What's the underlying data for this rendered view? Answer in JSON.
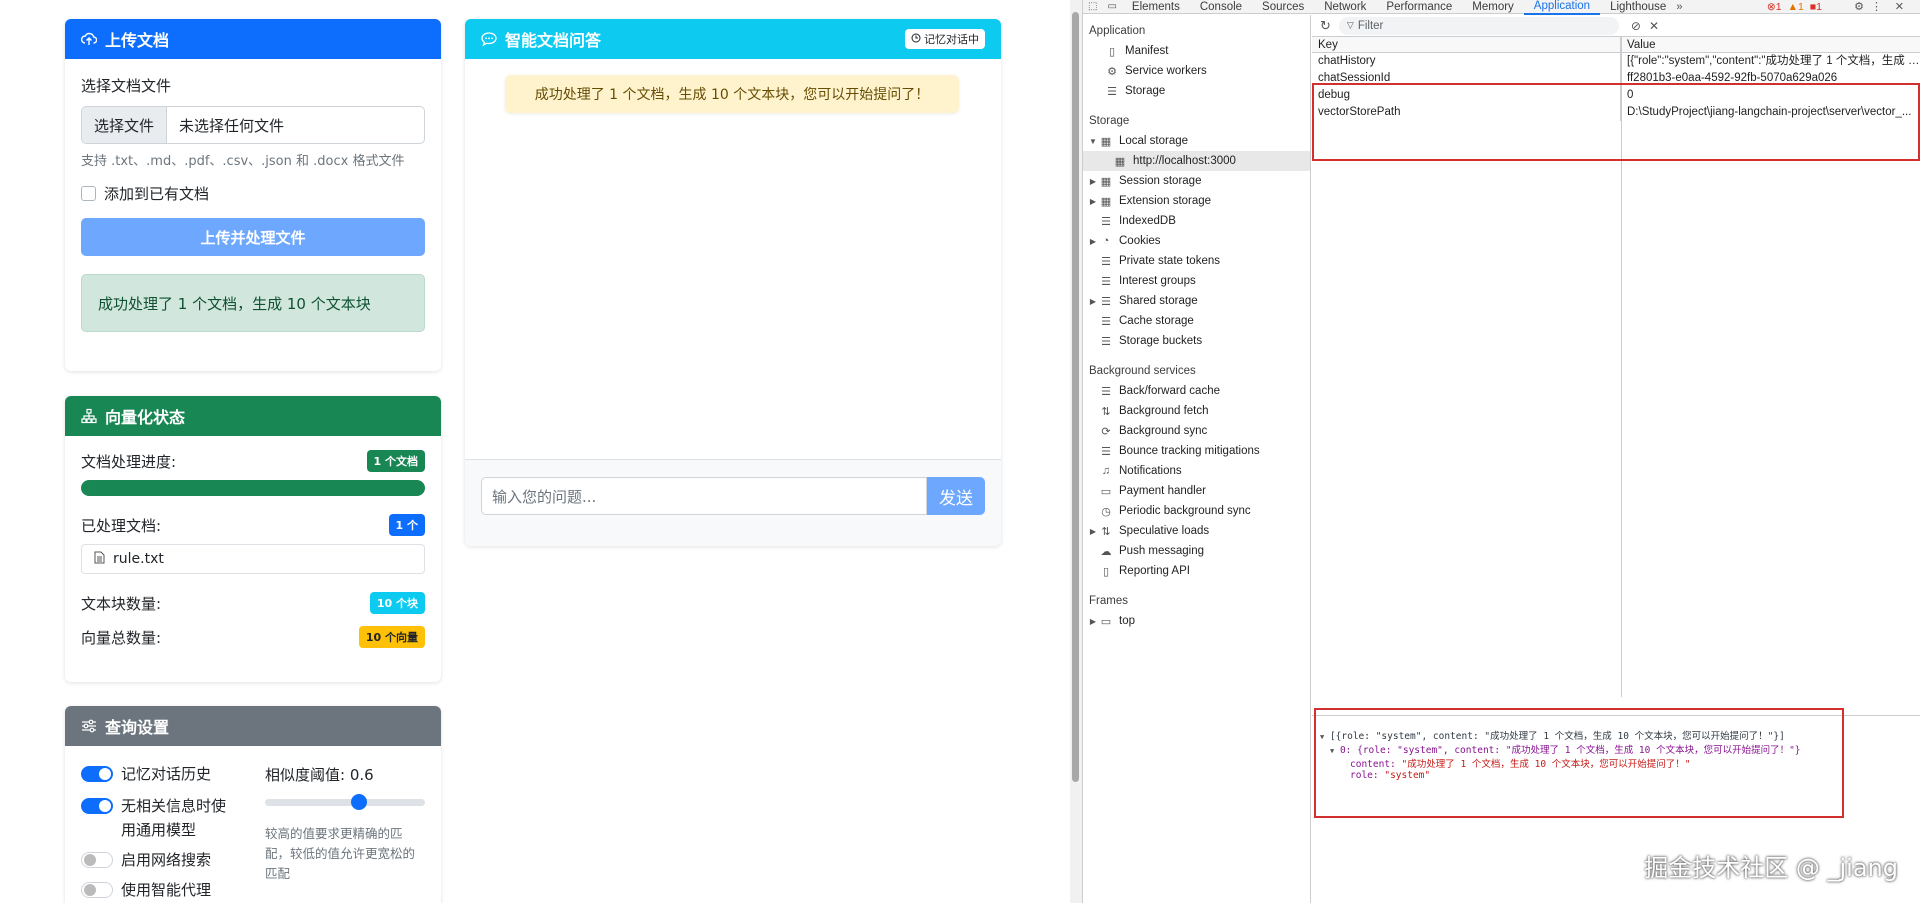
{
  "upload_card": {
    "title": "上传文档",
    "choose_label": "选择文档文件",
    "file_button": "选择文件",
    "file_name": "未选择任何文件",
    "hint": "支持 .txt、.md、.pdf、.csv、.json 和 .docx 格式文件",
    "append_label": "添加到已有文档",
    "upload_button": "上传并处理文件",
    "success_message": "成功处理了 1 个文档，生成 10 个文本块"
  },
  "vector_card": {
    "title": "向量化状态",
    "progress_label": "文档处理进度:",
    "progress_badge": "1 个文档",
    "progress_percent": 100,
    "processed_label": "已处理文档:",
    "processed_badge": "1 个",
    "files": [
      "rule.txt"
    ],
    "chunks_label": "文本块数量:",
    "chunks_badge": "10 个块",
    "vectors_label": "向量总数量:",
    "vectors_badge": "10 个向量"
  },
  "query_card": {
    "title": "查询设置",
    "toggles": [
      {
        "label": "记忆对话历史",
        "on": true
      },
      {
        "label": "无相关信息时使用通用模型",
        "on": true
      },
      {
        "label": "启用网络搜索",
        "on": false
      },
      {
        "label": "使用智能代理",
        "on": false
      }
    ],
    "threshold_label": "相似度阈值: 0.6",
    "threshold_value": 0.6,
    "threshold_hint": "较高的值要求更精确的匹配，较低的值允许更宽松的匹配"
  },
  "chat_card": {
    "title": "智能文档问答",
    "memory_badge": "记忆对话中",
    "system_message": "成功处理了 1 个文档，生成 10 个文本块，您可以开始提问了！",
    "input_placeholder": "输入您的问题...",
    "send_button": "发送"
  },
  "devtools": {
    "tabs": [
      "Elements",
      "Console",
      "Sources",
      "Network",
      "Performance",
      "Memory",
      "Application",
      "Lighthouse"
    ],
    "active_tab": "Application",
    "errors": "1",
    "warnings": "1",
    "issues": "1",
    "sidebar": {
      "application_title": "Application",
      "application_items": [
        "Manifest",
        "Service workers",
        "Storage"
      ],
      "storage_title": "Storage",
      "storage_items": [
        "Local storage",
        "http://localhost:3000",
        "Session storage",
        "Extension storage",
        "IndexedDB",
        "Cookies",
        "Private state tokens",
        "Interest groups",
        "Shared storage",
        "Cache storage",
        "Storage buckets"
      ],
      "background_title": "Background services",
      "background_items": [
        "Back/forward cache",
        "Background fetch",
        "Background sync",
        "Bounce tracking mitigations",
        "Notifications",
        "Payment handler",
        "Periodic background sync",
        "Speculative loads",
        "Push messaging",
        "Reporting API"
      ],
      "frames_title": "Frames",
      "frames_items": [
        "top"
      ]
    },
    "filter_placeholder": "Filter",
    "columns": [
      "Key",
      "Value"
    ],
    "rows": [
      {
        "key": "chatHistory",
        "value": "[{\"role\":\"system\",\"content\":\"成功处理了 1 个文档，生成 1..."
      },
      {
        "key": "chatSessionId",
        "value": "ff2801b3-e0aa-4592-92fb-5070a629a026"
      },
      {
        "key": "debug",
        "value": "0"
      },
      {
        "key": "vectorStorePath",
        "value": "D:\\StudyProject\\jiang-langchain-project\\server\\vector_..."
      }
    ],
    "preview": {
      "line1": "[{role: \"system\", content: \"成功处理了 1 个文档，生成 10 个文本块，您可以开始提问了！\"}]",
      "line2": "0: {role: \"system\", content: \"成功处理了 1 个文档，生成 10 个文本块，您可以开始提问了！\"}",
      "line3_key": "content:",
      "line3_val": "\"成功处理了 1 个文档，生成 10 个文本块，您可以开始提问了！\"",
      "line4_key": "role:",
      "line4_val": "\"system\""
    }
  },
  "watermark": "掘金技术社区 @ _jiang",
  "colors": {
    "primary": "#0d6efd",
    "success": "#198754",
    "info": "#0dcaf0",
    "secondary": "#6c757d",
    "warning": "#ffc107",
    "red_box": "#d32f2f"
  }
}
